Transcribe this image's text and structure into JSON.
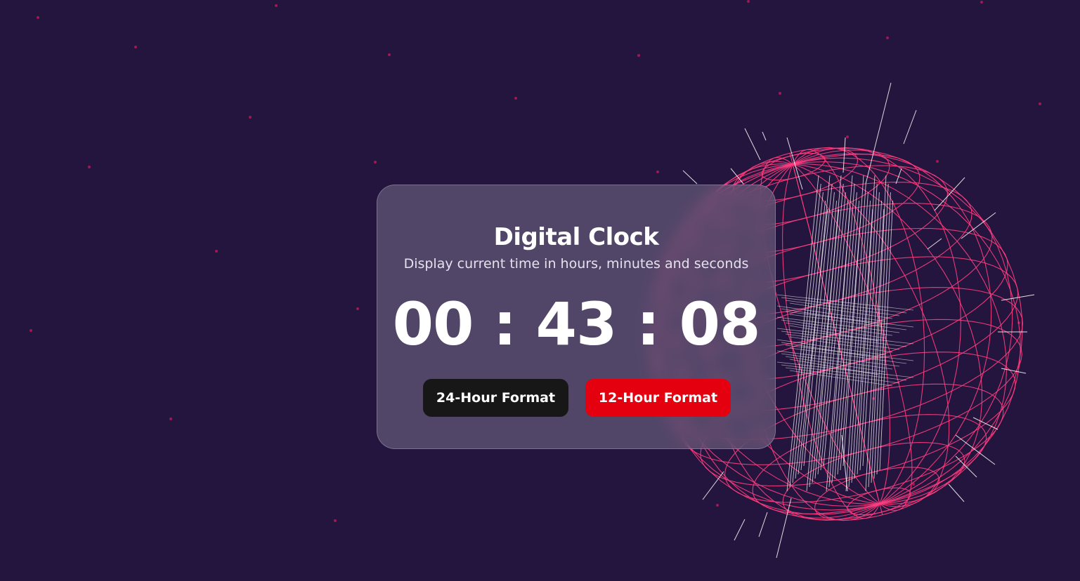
{
  "colors": {
    "background": "#23153d",
    "sphere_wire": "#ff3d7f",
    "sphere_spikes": "#ffffff",
    "star_dots": "#c2185b",
    "card_bg": "rgba(120,112,140,0.55)",
    "btn_24_bg": "#171717",
    "btn_12_bg": "#e4000f"
  },
  "decorations": {
    "sphere": "wireframe-globe-icon",
    "stars": "star-dot-icon"
  },
  "clock": {
    "title": "Digital Clock",
    "subtitle": "Display current time in hours, minutes and seconds",
    "time": "00 : 43 : 08",
    "hours": "00",
    "minutes": "43",
    "seconds": "08",
    "format_24_label": "24-Hour Format",
    "format_12_label": "12-Hour Format"
  }
}
